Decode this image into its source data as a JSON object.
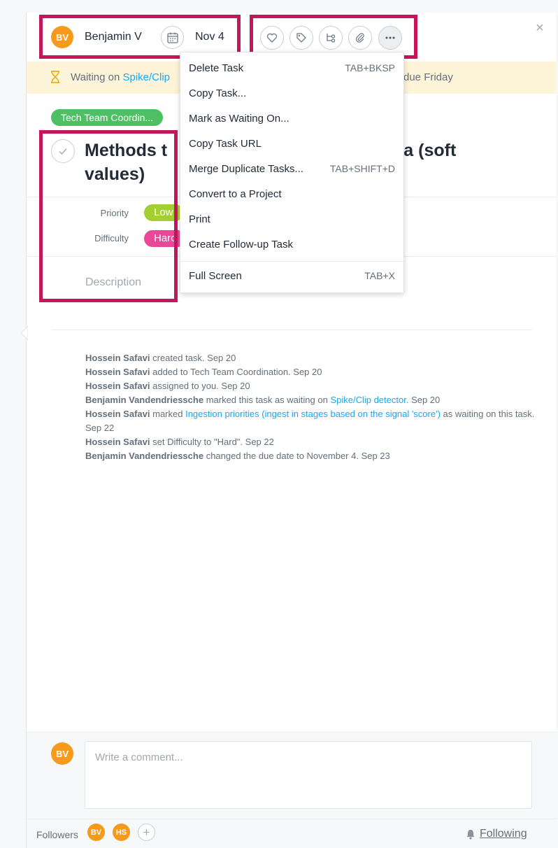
{
  "header": {
    "assignee_initials": "BV",
    "assignee_name": "Benjamin V",
    "due_date": "Nov 4",
    "close_glyph": "×"
  },
  "toolbar_icons": [
    "heart-icon",
    "tag-icon",
    "subtask-icon",
    "paperclip-icon",
    "more-icon"
  ],
  "waiting_banner": {
    "prefix": "Waiting on ",
    "link": "Spike/Clip",
    "suffix": "due Friday"
  },
  "project_tag": "Tech Team Coordin...",
  "task_title": "Methods t",
  "task_title_tail": "ata (soft",
  "task_title_line2": "values)",
  "fields": {
    "priority_label": "Priority",
    "priority_value": "Low",
    "difficulty_label": "Difficulty",
    "difficulty_value": "Harc"
  },
  "description_placeholder": "Description",
  "activity": [
    {
      "actor": "Hossein Safavi",
      "text": " created task.  Sep 20"
    },
    {
      "actor": "Hossein Safavi",
      "text": " added to Tech Team Coordination.  Sep 20"
    },
    {
      "actor": "Hossein Safavi",
      "text": " assigned to you.  Sep 20"
    },
    {
      "actor": "Benjamin Vandendriessche",
      "text": " marked this task as waiting on ",
      "link": "Spike/Clip detector.",
      "after": "  Sep 20"
    },
    {
      "actor": "Hossein Safavi",
      "text": " marked ",
      "link": "Ingestion priorities (ingest in stages based on the signal 'score')",
      "after": " as waiting on this task.  Sep 22"
    },
    {
      "actor": "Hossein Safavi",
      "text": " set Difficulty to \"Hard\".  Sep 22"
    },
    {
      "actor": "Benjamin Vandendriessche",
      "text": " changed the due date to November 4.  Sep 23"
    }
  ],
  "comment": {
    "avatar_initials": "BV",
    "placeholder": "Write a comment..."
  },
  "followers": {
    "label": "Followers",
    "list": [
      "BV",
      "HS"
    ],
    "add_glyph": "+",
    "following_label": "Following"
  },
  "menu": {
    "items": [
      {
        "label": "Delete Task",
        "shortcut": "TAB+BKSP"
      },
      {
        "label": "Copy Task...",
        "shortcut": ""
      },
      {
        "label": "Mark as Waiting On...",
        "shortcut": ""
      },
      {
        "label": "Copy Task URL",
        "shortcut": ""
      },
      {
        "label": "Merge Duplicate Tasks...",
        "shortcut": "TAB+SHIFT+D"
      },
      {
        "label": "Convert to a Project",
        "shortcut": ""
      },
      {
        "label": "Print",
        "shortcut": ""
      },
      {
        "label": "Create Follow-up Task",
        "shortcut": ""
      },
      {
        "label": "Full Screen",
        "shortcut": "TAB+X"
      }
    ]
  },
  "colors": {
    "highlight": "#c2185b",
    "avatar": "#f79a1c",
    "project": "#4fbf64",
    "low": "#a4cf30",
    "hard": "#e8489a",
    "link": "#14aaf5"
  }
}
